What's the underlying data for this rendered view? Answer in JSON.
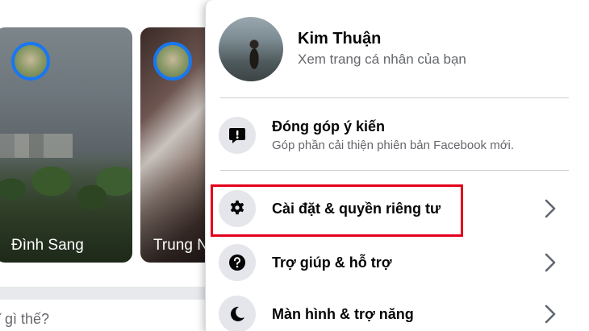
{
  "stories": [
    {
      "name": "Đình Sang"
    },
    {
      "name": "Trung N"
    }
  ],
  "composer": {
    "hint": "ĩ gì thế?"
  },
  "profile": {
    "name": "Kim Thuận",
    "subtitle": "Xem trang cá nhân của bạn"
  },
  "menu": {
    "feedback": {
      "label": "Đóng góp ý kiến",
      "sublabel": "Góp phần cải thiện phiên bản Facebook mới.",
      "icon": "feedback-exclamation-icon"
    },
    "items": [
      {
        "label": "Cài đặt & quyền riêng tư",
        "icon": "gear-icon",
        "highlighted": true
      },
      {
        "label": "Trợ giúp & hỗ trợ",
        "icon": "help-question-icon"
      },
      {
        "label": "Màn hình & trợ năng",
        "icon": "moon-icon"
      }
    ]
  },
  "colors": {
    "highlight": "#e3001b",
    "story_ring": "#1877f2",
    "icon_bg": "#e4e6eb"
  }
}
